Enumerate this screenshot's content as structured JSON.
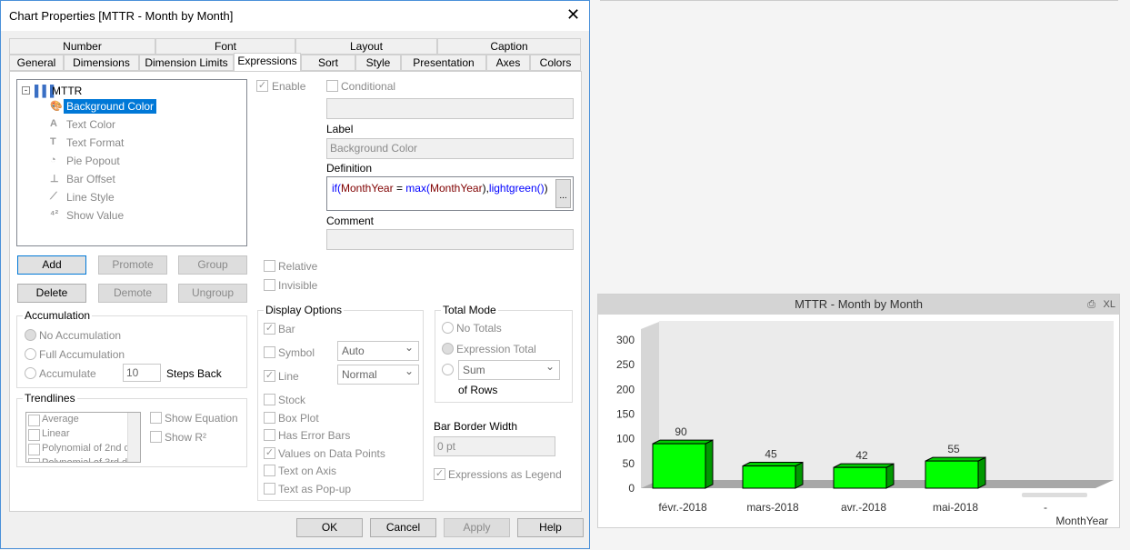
{
  "dialog": {
    "title": "Chart Properties [MTTR - Month by Month]",
    "tabs_row1": [
      "Number",
      "Font",
      "Layout",
      "Caption"
    ],
    "tabs_row2": [
      "General",
      "Dimensions",
      "Dimension Limits",
      "Expressions",
      "Sort",
      "Style",
      "Presentation",
      "Axes",
      "Colors"
    ],
    "tree": {
      "root": "MTTR",
      "items": [
        "Background Color",
        "Text Color",
        "Text Format",
        "Pie Popout",
        "Bar Offset",
        "Line Style",
        "Show Value"
      ]
    },
    "enable": "Enable",
    "conditional": "Conditional",
    "label_caption": "Label",
    "label_value": "Background Color",
    "definition_caption": "Definition",
    "definition": [
      {
        "t": "if(",
        "c": "#0000ff"
      },
      {
        "t": "MonthYear",
        "c": "#800000"
      },
      {
        "t": " = ",
        "c": "#000"
      },
      {
        "t": "max(",
        "c": "#0000ff"
      },
      {
        "t": "MonthYear",
        "c": "#800000"
      },
      {
        "t": "),",
        "c": "#000"
      },
      {
        "t": "lightgreen()",
        "c": "#0000ff"
      },
      {
        "t": ")",
        "c": "#000"
      }
    ],
    "ellipsis": "...",
    "comment_caption": "Comment",
    "buttons": {
      "add": "Add",
      "promote": "Promote",
      "group": "Group",
      "delete": "Delete",
      "demote": "Demote",
      "ungroup": "Ungroup"
    },
    "relative": "Relative",
    "invisible": "Invisible",
    "accumulation": {
      "title": "Accumulation",
      "no": "No Accumulation",
      "full": "Full Accumulation",
      "acc": "Accumulate",
      "steps": "10",
      "steps_back": "Steps Back"
    },
    "trendlines": {
      "title": "Trendlines",
      "items": [
        "Average",
        "Linear",
        "Polynomial of 2nd d",
        "Polynomial of 3rd d"
      ],
      "show_equation": "Show Equation",
      "show_r2": "Show R²"
    },
    "display_options": {
      "title": "Display Options",
      "bar": "Bar",
      "symbol": "Symbol",
      "symbol_value": "Auto",
      "line": "Line",
      "line_value": "Normal",
      "stock": "Stock",
      "box_plot": "Box Plot",
      "error_bars": "Has Error Bars",
      "values_on_points": "Values on Data Points",
      "text_on_axis": "Text on Axis",
      "text_popup": "Text as Pop-up"
    },
    "total_mode": {
      "title": "Total Mode",
      "no_totals": "No Totals",
      "expr_total": "Expression Total",
      "sum": "Sum",
      "of_rows": "of Rows"
    },
    "bar_border": {
      "title": "Bar Border Width",
      "value": "0 pt"
    },
    "expr_legend": "Expressions as Legend",
    "footer": {
      "ok": "OK",
      "cancel": "Cancel",
      "apply": "Apply",
      "help": "Help"
    }
  },
  "chart_data": {
    "type": "bar",
    "title": "MTTR - Month by Month",
    "categories": [
      "févr.-2018",
      "mars-2018",
      "avr.-2018",
      "mai-2018",
      "-"
    ],
    "values": [
      90,
      45,
      42,
      55,
      null
    ],
    "xlabel": "MonthYear",
    "ylabel": "",
    "ylim": [
      0,
      300
    ],
    "yticks": [
      "0",
      "50",
      "100",
      "150",
      "200",
      "250",
      "300"
    ],
    "bar_color": "#00ff00",
    "xl_label": "XL"
  }
}
